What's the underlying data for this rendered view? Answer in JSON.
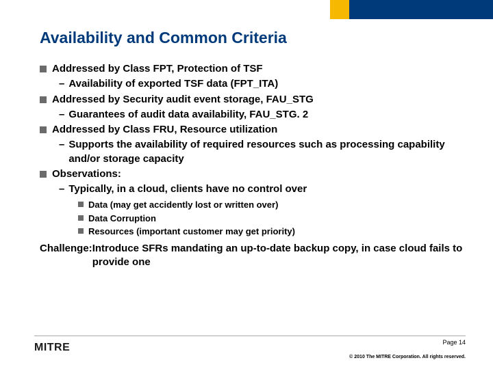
{
  "header": {
    "title": "Availability and Common Criteria"
  },
  "bullets": [
    {
      "text": "Addressed by Class FPT, Protection of TSF",
      "sub": [
        {
          "text": "Availability of exported TSF data (FPT_ITA)"
        }
      ]
    },
    {
      "text": "Addressed by Security audit event storage, FAU_STG",
      "sub": [
        {
          "text": "Guarantees of audit data availability, FAU_STG. 2"
        }
      ]
    },
    {
      "text": "Addressed by Class FRU, Resource utilization",
      "sub": [
        {
          "text": "Supports the availability of required resources such as processing capability and/or storage capacity"
        }
      ]
    },
    {
      "text": "Observations:",
      "sub": [
        {
          "text": "Typically, in a cloud, clients have no control over",
          "subsub": [
            "Data (may get accidently lost or written over)",
            "Data Corruption",
            "Resources (important customer may get priority)"
          ]
        }
      ]
    }
  ],
  "challenge": {
    "label": "Challenge: ",
    "text": "Introduce SFRs mandating an up-to-date backup copy, in case cloud fails to provide one"
  },
  "footer": {
    "logo_main": "MITRE",
    "page_label": "Page ",
    "page_num": "14",
    "copyright": "© 2010 The MITRE Corporation. All rights reserved."
  }
}
